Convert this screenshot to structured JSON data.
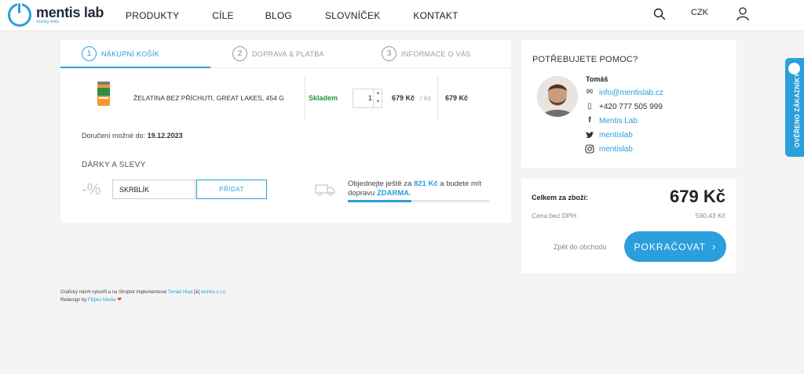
{
  "header": {
    "logo": {
      "name": "mentis lab",
      "tagline": "moving limits"
    },
    "nav": [
      "PRODUKTY",
      "CÍLE",
      "BLOG",
      "SLOVNÍČEK",
      "KONTAKT"
    ],
    "currency": "CZK",
    "icons": {
      "search": "search-icon",
      "user": "user-icon"
    }
  },
  "steps": [
    {
      "num": "1",
      "label": "NÁKUPNÍ KOŠÍK",
      "active": true
    },
    {
      "num": "2",
      "label": "DOPRAVA & PLATBA",
      "active": false
    },
    {
      "num": "3",
      "label": "INFORMACE O VÁS",
      "active": false
    }
  ],
  "cart": {
    "item": {
      "name": "ŽELATINA BEZ PŘÍCHUTI, GREAT LAKES, 454 G",
      "stock": "Skladem",
      "quantity": "1",
      "unit_price": "679 Kč",
      "unit_sep": "/ ks",
      "total": "679 Kč"
    },
    "delivery_label": "Doručení možné do:",
    "delivery_date": "19.12.2023"
  },
  "gifts": {
    "title": "DÁRKY A SLEVY",
    "percent_symbol": "-%",
    "coupon_value": "SKRBLÍK",
    "add_label": "PŘIDAT"
  },
  "shipping": {
    "text_before": "Objednejte ještě za",
    "remaining": "821 Kč",
    "text_middle": "a budete mít dopravu",
    "free": "ZDARMA",
    "text_after": ".",
    "progress_fraction": 0.45
  },
  "help": {
    "title": "POTŘEBUJETE POMOC?",
    "name": "Tomáš",
    "email": "info@mentislab.cz",
    "phone": "+420 777 505 999",
    "facebook": "Mentis Lab",
    "twitter": "mentislab",
    "instagram": "mentislab"
  },
  "summary": {
    "total_label": "Celkem za zboží:",
    "total_value": "679 Kč",
    "vat_label": "Cena bez DPH:",
    "vat_value": "590,43 Kč",
    "back_label": "Zpět do obchodu",
    "continue_label": "POKRAČOVAT"
  },
  "footer": {
    "line1_a": "Grafický návrh vytvořil a na Shoptet implementoval",
    "line1_author": "Tomáš Hlad",
    "line1_sep": "[&]",
    "line1_company": "techka s.r.o.",
    "line2_a": "Redesign by",
    "line2_author": "Filipes Media"
  },
  "badge": {
    "label": "OVĚŘENO ZÁKAZNÍKY"
  },
  "colors": {
    "accent": "#2a9fdc",
    "stock": "#1f9a38"
  }
}
